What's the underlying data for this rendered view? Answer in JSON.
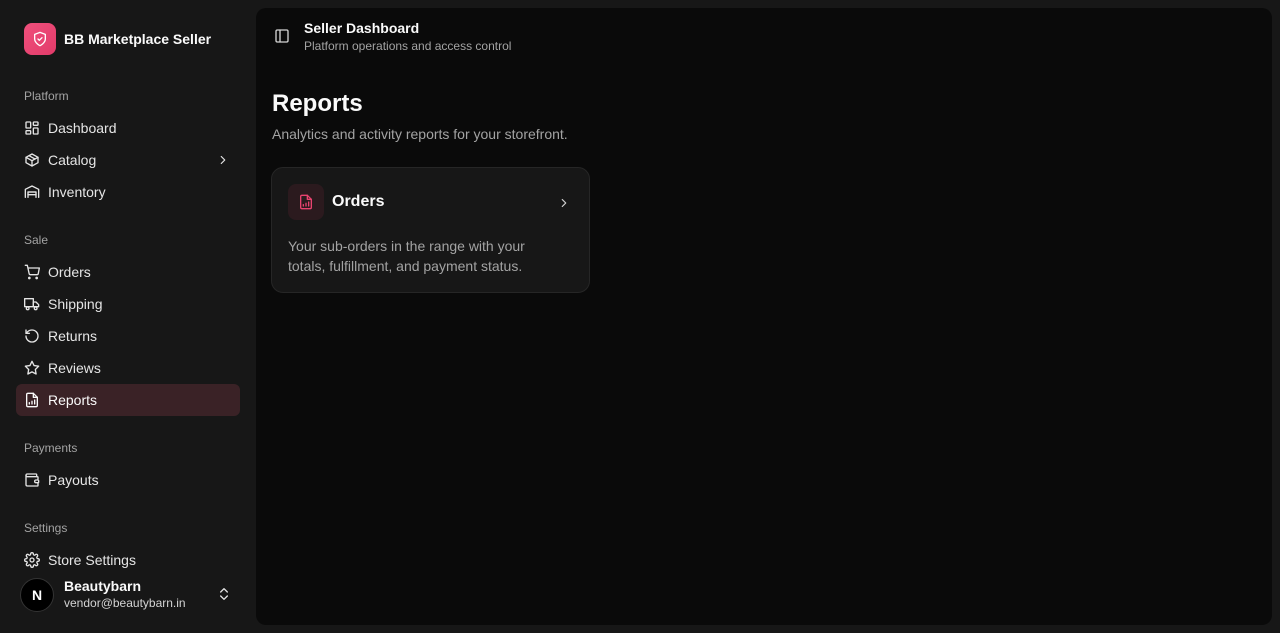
{
  "brand": {
    "name": "BB Marketplace Seller",
    "logo_icon": "shield-icon",
    "accent": "#e8436f"
  },
  "sidebar": {
    "groups": [
      {
        "label": "Platform",
        "items": [
          {
            "label": "Dashboard",
            "icon": "dashboard-icon"
          },
          {
            "label": "Catalog",
            "icon": "package-icon",
            "has_submenu": true
          },
          {
            "label": "Inventory",
            "icon": "warehouse-icon"
          }
        ]
      },
      {
        "label": "Sale",
        "items": [
          {
            "label": "Orders",
            "icon": "cart-icon"
          },
          {
            "label": "Shipping",
            "icon": "truck-icon"
          },
          {
            "label": "Returns",
            "icon": "rotate-ccw-icon"
          },
          {
            "label": "Reviews",
            "icon": "star-icon"
          },
          {
            "label": "Reports",
            "icon": "file-chart-icon",
            "active": true
          }
        ]
      },
      {
        "label": "Payments",
        "items": [
          {
            "label": "Payouts",
            "icon": "wallet-icon"
          }
        ]
      },
      {
        "label": "Settings",
        "items": [
          {
            "label": "Store Settings",
            "icon": "gear-icon"
          }
        ]
      }
    ]
  },
  "user": {
    "avatar_letter": "N",
    "name": "Beautybarn",
    "email": "vendor@beautybarn.in"
  },
  "topbar": {
    "title": "Seller Dashboard",
    "subtitle": "Platform operations and access control"
  },
  "page": {
    "title": "Reports",
    "description": "Analytics and activity reports for your storefront."
  },
  "cards": [
    {
      "title": "Orders",
      "icon": "file-chart-icon",
      "description": "Your sub-orders in the range with your totals, fulfillment, and payment status."
    }
  ]
}
